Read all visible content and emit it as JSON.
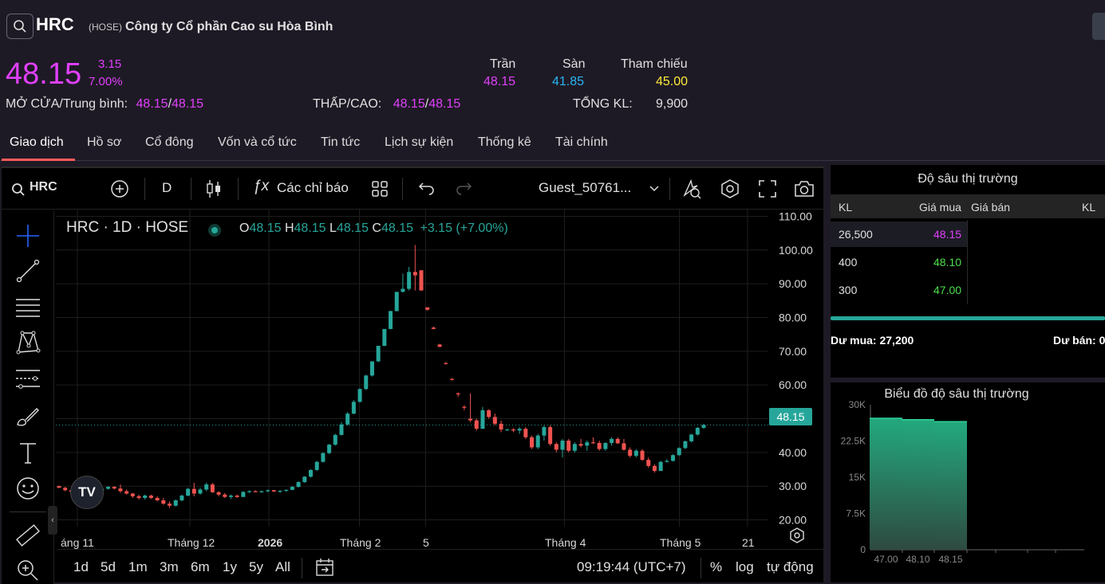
{
  "header": {
    "symbol": "HRC",
    "exchange": "(HOSE)",
    "company_name": "Công ty Cổ phần Cao su Hòa Bình",
    "price": "48.15",
    "change": "3.15",
    "change_pct": "7.00%",
    "open_avg_label": "MỞ CỬA/Trung bình:",
    "open": "48.15",
    "avg": "48.15",
    "low_high_label": "THẤP/CAO:",
    "low": "48.15",
    "high": "48.15",
    "ceiling_label": "Trần",
    "ceiling": "48.15",
    "floor_label": "Sàn",
    "floor": "41.85",
    "ref_label": "Tham chiếu",
    "ref": "45.00",
    "volume_label": "TỔNG KL:",
    "volume": "9,900",
    "sep": "/"
  },
  "tabs": [
    "Giao dịch",
    "Hồ sơ",
    "Cổ đông",
    "Vốn và cổ tức",
    "Tin tức",
    "Lịch sự kiện",
    "Thống kê",
    "Tài chính"
  ],
  "toolbar": {
    "symbol": "HRC",
    "interval": "D",
    "indicators": "Các chỉ báo",
    "user": "Guest_50761..."
  },
  "legend": {
    "title": "HRC · 1D · HOSE",
    "o_label": "O",
    "o": "48.15",
    "h_label": "H",
    "h": "48.15",
    "l_label": "L",
    "l": "48.15",
    "c_label": "C",
    "c": "48.15",
    "chg": "+3.15 (+7.00%)"
  },
  "price_axis": [
    "110.00",
    "100.00",
    "90.00",
    "80.00",
    "70.00",
    "60.00",
    "50.00",
    "40.00",
    "30.00",
    "20.00"
  ],
  "last_price_tag": "48.15",
  "time_axis": [
    "áng 11",
    "Tháng 12",
    "2026",
    "Tháng 2",
    "5",
    "Tháng 4",
    "Tháng 5",
    "21"
  ],
  "bottom_bar": {
    "ranges": [
      "1d",
      "5d",
      "1m",
      "3m",
      "6m",
      "1y",
      "5y",
      "All"
    ],
    "time": "09:19:44 (UTC+7)",
    "pct": "%",
    "log": "log",
    "auto": "tự động"
  },
  "depth": {
    "title": "Độ sâu thị trường",
    "headers": {
      "kl": "KL",
      "bid": "Giá mua",
      "ask": "Giá bán",
      "kl2": "KL"
    },
    "rows": [
      {
        "kl": "26,500",
        "bid": "48.15"
      },
      {
        "kl": "400",
        "bid": "48.10"
      },
      {
        "kl": "300",
        "bid": "47.00"
      }
    ],
    "buy_label": "Dư mua: 27,200",
    "sell_label": "Dư bán: 0"
  },
  "depth_chart": {
    "title": "Biểu đồ độ sâu thị trường",
    "y_ticks": [
      "30K",
      "22.5K",
      "15K",
      "7.5K",
      "0"
    ],
    "x_ticks": [
      "47.00",
      "48.10",
      "48.15"
    ]
  },
  "chart_data": {
    "type": "candlestick",
    "y_range": [
      18,
      112
    ],
    "colors": {
      "up": "#26a69a",
      "down": "#ef5350"
    },
    "candles": [
      [
        30.0,
        30.2,
        29.5,
        29.5
      ],
      [
        29.5,
        29.8,
        28.5,
        28.8
      ],
      [
        28.8,
        29.0,
        28.0,
        28.3
      ],
      [
        28.3,
        28.8,
        27.5,
        28.0
      ],
      [
        28.0,
        28.5,
        27.5,
        28.3
      ],
      [
        28.3,
        28.6,
        27.8,
        28.0
      ],
      [
        28.0,
        29.0,
        27.8,
        28.8
      ],
      [
        28.8,
        29.5,
        28.5,
        29.2
      ],
      [
        29.2,
        30.0,
        29.0,
        29.8
      ],
      [
        29.8,
        30.0,
        29.0,
        29.3
      ],
      [
        29.3,
        30.5,
        28.0,
        28.5
      ],
      [
        28.5,
        29.0,
        27.5,
        27.8
      ],
      [
        27.8,
        28.0,
        26.5,
        27.0
      ],
      [
        27.0,
        27.5,
        26.0,
        26.5
      ],
      [
        26.5,
        27.5,
        26.0,
        27.2
      ],
      [
        27.2,
        27.5,
        26.2,
        26.5
      ],
      [
        26.5,
        27.0,
        25.5,
        25.8
      ],
      [
        25.8,
        26.5,
        24.5,
        24.8
      ],
      [
        24.8,
        25.5,
        23.5,
        24.2
      ],
      [
        24.2,
        26.0,
        24.0,
        25.8
      ],
      [
        25.8,
        27.5,
        25.5,
        27.2
      ],
      [
        27.2,
        29.5,
        27.0,
        29.2
      ],
      [
        29.2,
        31.0,
        27.0,
        27.8
      ],
      [
        27.8,
        29.5,
        27.5,
        29.0
      ],
      [
        29.0,
        31.0,
        28.5,
        30.5
      ],
      [
        30.5,
        31.0,
        28.0,
        28.2
      ],
      [
        28.2,
        28.5,
        27.0,
        27.5
      ],
      [
        27.5,
        28.0,
        26.5,
        26.8
      ],
      [
        26.8,
        27.5,
        26.2,
        27.2
      ],
      [
        27.2,
        27.5,
        26.5,
        26.8
      ],
      [
        26.8,
        28.5,
        26.8,
        28.3
      ],
      [
        28.3,
        28.8,
        28.0,
        28.5
      ],
      [
        28.5,
        28.8,
        28.2,
        28.4
      ],
      [
        28.4,
        28.7,
        28.0,
        28.5
      ],
      [
        28.5,
        29.0,
        28.2,
        28.8
      ],
      [
        28.8,
        28.9,
        28.3,
        28.4
      ],
      [
        28.4,
        28.8,
        28.0,
        28.6
      ],
      [
        28.6,
        29.0,
        28.3,
        28.9
      ],
      [
        28.9,
        30.0,
        28.8,
        29.8
      ],
      [
        29.8,
        31.5,
        29.6,
        31.2
      ],
      [
        31.2,
        33.0,
        31.0,
        32.8
      ],
      [
        32.8,
        35.0,
        32.5,
        34.8
      ],
      [
        34.8,
        37.5,
        34.5,
        37.2
      ],
      [
        37.2,
        40.0,
        37.0,
        39.8
      ],
      [
        39.8,
        42.5,
        39.5,
        42.3
      ],
      [
        42.3,
        45.5,
        42.0,
        45.2
      ],
      [
        45.2,
        49.0,
        45.0,
        48.3
      ],
      [
        48.3,
        52.0,
        48.0,
        51.5
      ],
      [
        51.5,
        55.5,
        51.3,
        55.0
      ],
      [
        55.0,
        59.0,
        54.8,
        58.8
      ],
      [
        58.8,
        63.0,
        58.5,
        62.8
      ],
      [
        62.8,
        67.0,
        62.5,
        67.0
      ],
      [
        67.0,
        71.5,
        66.8,
        71.6
      ],
      [
        71.6,
        76.5,
        71.5,
        76.6
      ],
      [
        76.6,
        82.0,
        76.5,
        81.9
      ],
      [
        81.9,
        87.5,
        81.8,
        87.6
      ],
      [
        87.6,
        93.0,
        87.4,
        88.5
      ],
      [
        88.5,
        95.0,
        88.0,
        93.5
      ],
      [
        93.5,
        101.5,
        88.0,
        92.5
      ],
      [
        94.0,
        94.0,
        88.0,
        88.0
      ],
      [
        83.0,
        83.0,
        82.0,
        82.3
      ],
      [
        77.0,
        77.3,
        76.5,
        76.6
      ],
      [
        72.0,
        72.2,
        71.2,
        71.3
      ],
      [
        66.5,
        66.8,
        66.0,
        66.3
      ],
      [
        61.8,
        62.0,
        61.3,
        61.6
      ],
      [
        57.5,
        57.8,
        56.5,
        57.3
      ],
      [
        53.5,
        54.0,
        52.5,
        53.3
      ],
      [
        50.0,
        57.5,
        49.0,
        49.5
      ],
      [
        49.5,
        50.0,
        46.5,
        47.0
      ],
      [
        47.0,
        53.5,
        47.0,
        52.5
      ],
      [
        52.5,
        52.8,
        50.0,
        50.5
      ],
      [
        50.5,
        51.5,
        48.0,
        48.5
      ],
      [
        48.5,
        49.5,
        46.0,
        46.8
      ],
      [
        46.8,
        47.0,
        46.5,
        46.8
      ],
      [
        46.8,
        47.2,
        46.0,
        46.5
      ],
      [
        46.5,
        47.5,
        45.5,
        47.0
      ],
      [
        47.0,
        47.5,
        44.0,
        44.5
      ],
      [
        44.5,
        45.0,
        41.0,
        41.5
      ],
      [
        41.5,
        45.5,
        41.0,
        45.0
      ],
      [
        45.0,
        48.0,
        43.5,
        47.5
      ],
      [
        47.5,
        48.0,
        42.0,
        42.5
      ],
      [
        42.5,
        43.0,
        40.0,
        40.8
      ],
      [
        40.8,
        44.0,
        38.5,
        43.5
      ],
      [
        43.5,
        44.0,
        40.0,
        40.5
      ],
      [
        40.5,
        43.0,
        40.0,
        42.5
      ],
      [
        42.5,
        44.0,
        41.5,
        42.0
      ],
      [
        42.0,
        43.5,
        40.5,
        43.0
      ],
      [
        43.0,
        44.5,
        42.5,
        42.8
      ],
      [
        42.8,
        43.5,
        40.5,
        41.0
      ],
      [
        41.0,
        43.0,
        40.5,
        42.8
      ],
      [
        42.8,
        44.5,
        42.0,
        44.0
      ],
      [
        44.0,
        44.5,
        42.5,
        42.7
      ],
      [
        42.7,
        44.0,
        40.5,
        40.8
      ],
      [
        40.8,
        41.5,
        38.5,
        39.0
      ],
      [
        39.0,
        41.0,
        38.5,
        40.5
      ],
      [
        40.5,
        41.0,
        37.5,
        37.8
      ],
      [
        37.8,
        38.5,
        35.5,
        36.0
      ],
      [
        36.0,
        36.5,
        34.0,
        34.5
      ],
      [
        34.5,
        37.5,
        34.5,
        37.2
      ],
      [
        37.2,
        38.0,
        37.0,
        37.5
      ],
      [
        37.5,
        39.5,
        37.3,
        39.2
      ],
      [
        39.2,
        41.5,
        39.0,
        41.3
      ],
      [
        41.3,
        43.5,
        41.0,
        43.3
      ],
      [
        43.3,
        45.5,
        43.0,
        45.3
      ],
      [
        45.3,
        47.5,
        45.0,
        47.3
      ],
      [
        47.3,
        48.5,
        47.0,
        48.15
      ]
    ],
    "depth_bids": [
      {
        "price": "47.00",
        "cum_volume": 27200
      },
      {
        "price": "48.10",
        "cum_volume": 26900
      },
      {
        "price": "48.15",
        "cum_volume": 26500
      }
    ],
    "depth_y_range": [
      0,
      30000
    ]
  }
}
